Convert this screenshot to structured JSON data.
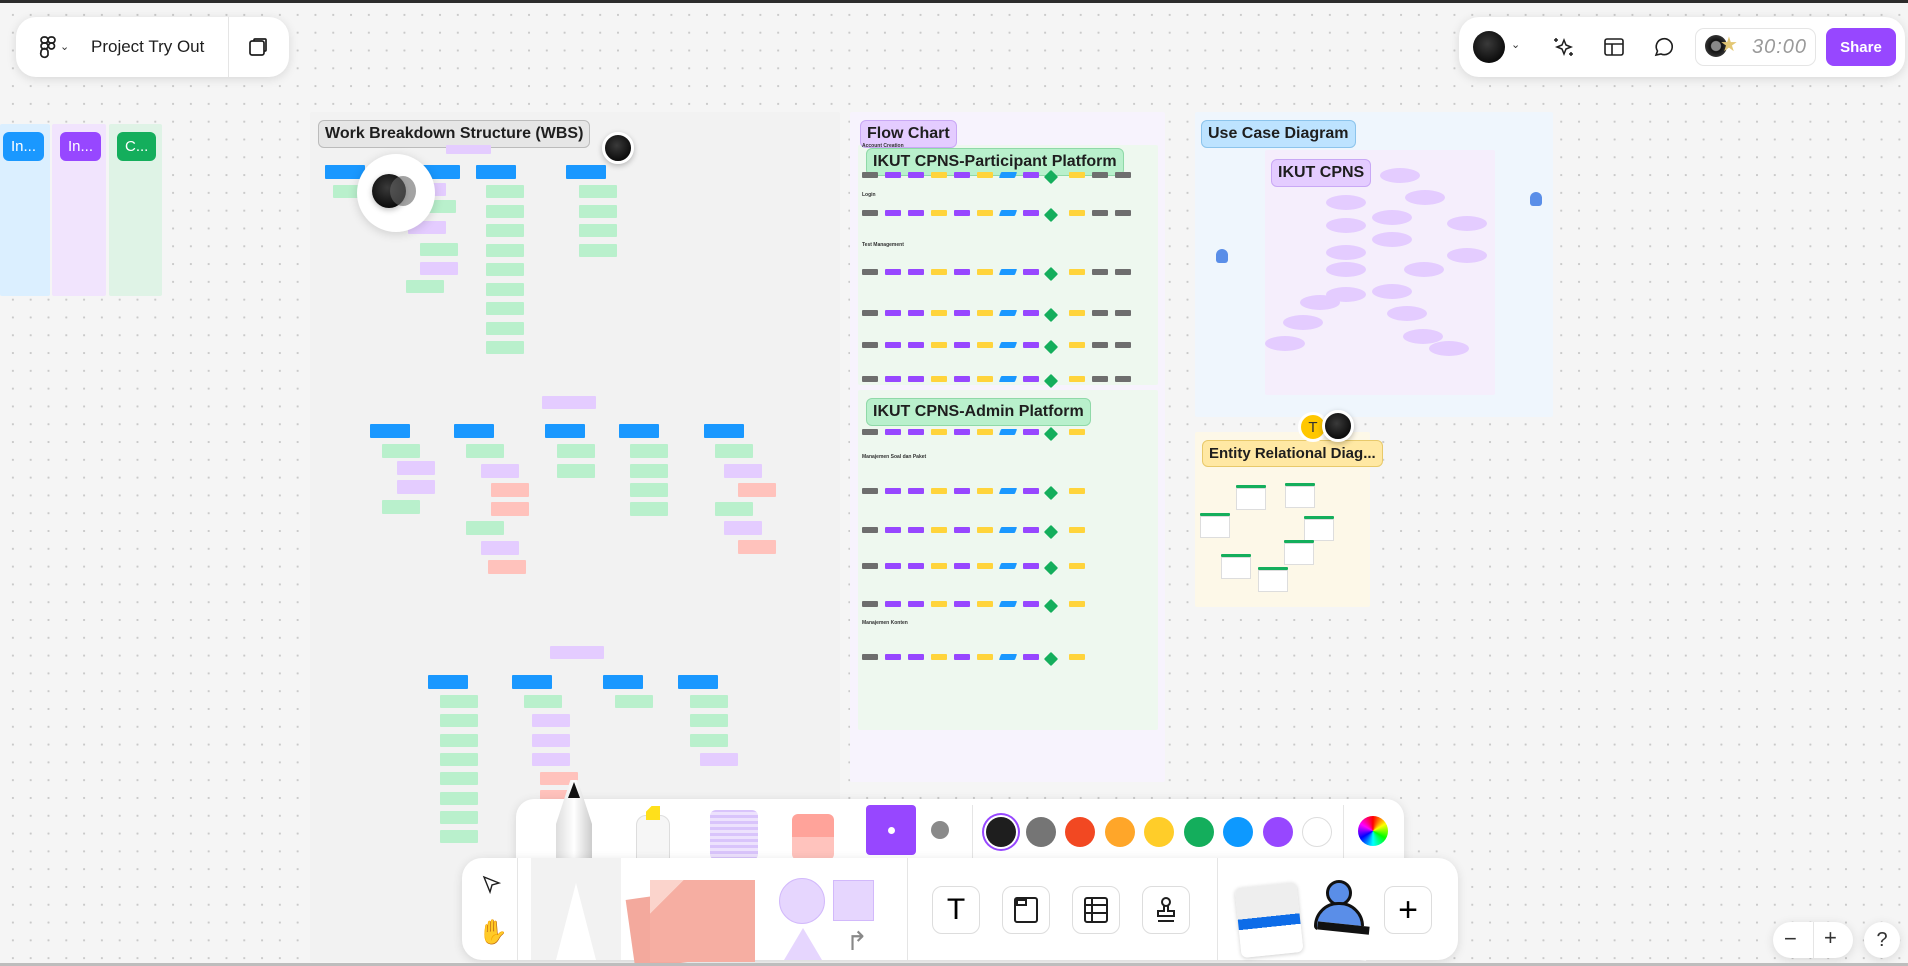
{
  "app": {
    "file_title": "Project Try Out",
    "menu_icon": "figjam-logo-icon",
    "pages_icon": "pages-icon"
  },
  "top_right": {
    "avatar_menu": "user-avatar",
    "ai_icon": "sparkles-icon",
    "templates_icon": "layout-icon",
    "comment_icon": "comment-icon",
    "timer": "30:00",
    "share_label": "Share",
    "accent": "#9747ff"
  },
  "left_columns": [
    {
      "label": "In...",
      "color": "#1a98ff"
    },
    {
      "label": "In...",
      "color": "#9747ff"
    },
    {
      "label": "C...",
      "color": "#14ae5c"
    }
  ],
  "sections": {
    "wbs": {
      "title": "Work Breakdown Structure (WBS)"
    },
    "flow": {
      "title": "Flow Chart",
      "participant": "IKUT CPNS-Participant Platform",
      "admin": "IKUT CPNS-Admin Platform",
      "subheads": [
        "Account Creation",
        "Login",
        "Test Management",
        "Manajemen Soal dan Paket",
        "Manajemen Konten"
      ]
    },
    "usecase": {
      "title": "Use Case Diagram",
      "system": "IKUT CPNS"
    },
    "erd": {
      "title": "Entity Relational Diag..."
    }
  },
  "collaborators": [
    {
      "initial": "T",
      "color": "#ffc700"
    },
    {
      "initial": "",
      "color": "#111111"
    }
  ],
  "color_toolbar": {
    "tools": [
      "marker-tool",
      "highlighter-tool",
      "washi-tape-tool",
      "eraser-tool"
    ],
    "stroke_sizes": [
      "thick",
      "thin"
    ],
    "colors": [
      "#1e1e1e",
      "#757575",
      "#f24822",
      "#ffa629",
      "#ffcd29",
      "#14ae5c",
      "#0d99ff",
      "#9747ff",
      "#ffffff"
    ],
    "selected_color": "#1e1e1e"
  },
  "bottom_toolbar": {
    "select_icon": "cursor-icon",
    "hand_icon": "hand-icon",
    "tools": [
      "text-tool",
      "section-tool",
      "table-tool",
      "stamp-tool"
    ],
    "more_label": "+"
  },
  "zoom_controls": {
    "minus": "−",
    "plus": "+",
    "help": "?"
  }
}
